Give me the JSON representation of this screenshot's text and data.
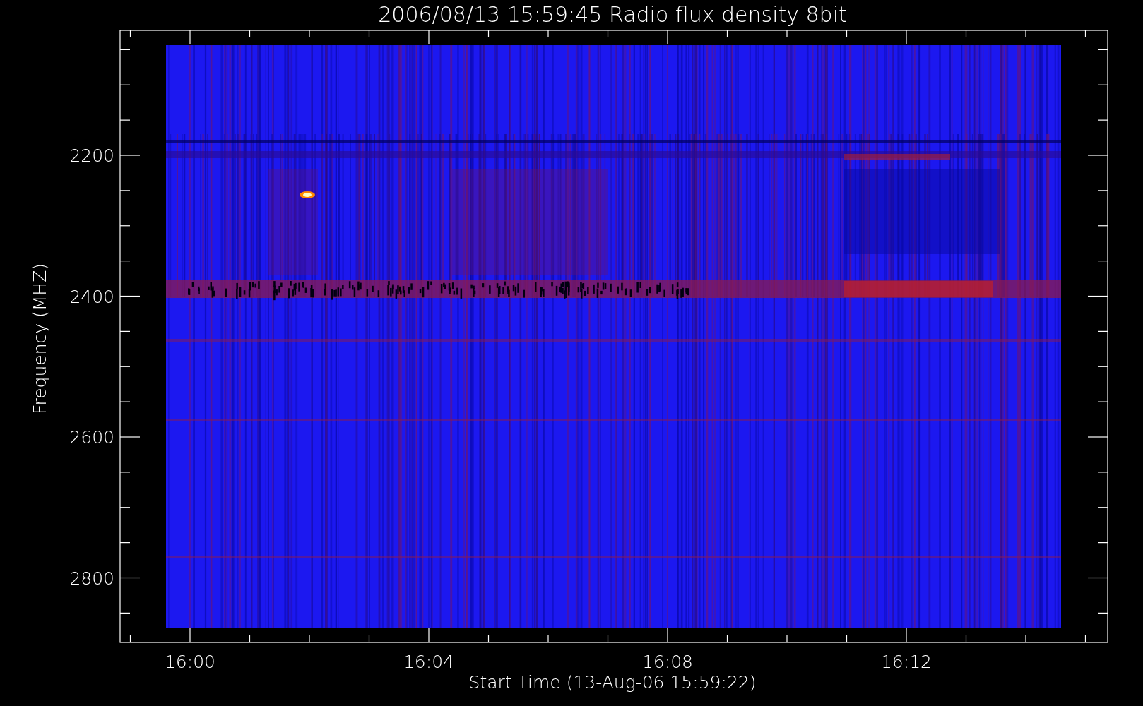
{
  "plot": {
    "title": "2006/08/13 15:59:45 Radio flux density 8bit",
    "ylabel": "Frequency (MHZ)",
    "xlabel": "Start Time (13-Aug-06 15:59:22)",
    "yticks": [
      "2200",
      "2400",
      "2600",
      "2800"
    ],
    "xticks": [
      "16:00",
      "16:04",
      "16:08",
      "16:12"
    ]
  }
}
